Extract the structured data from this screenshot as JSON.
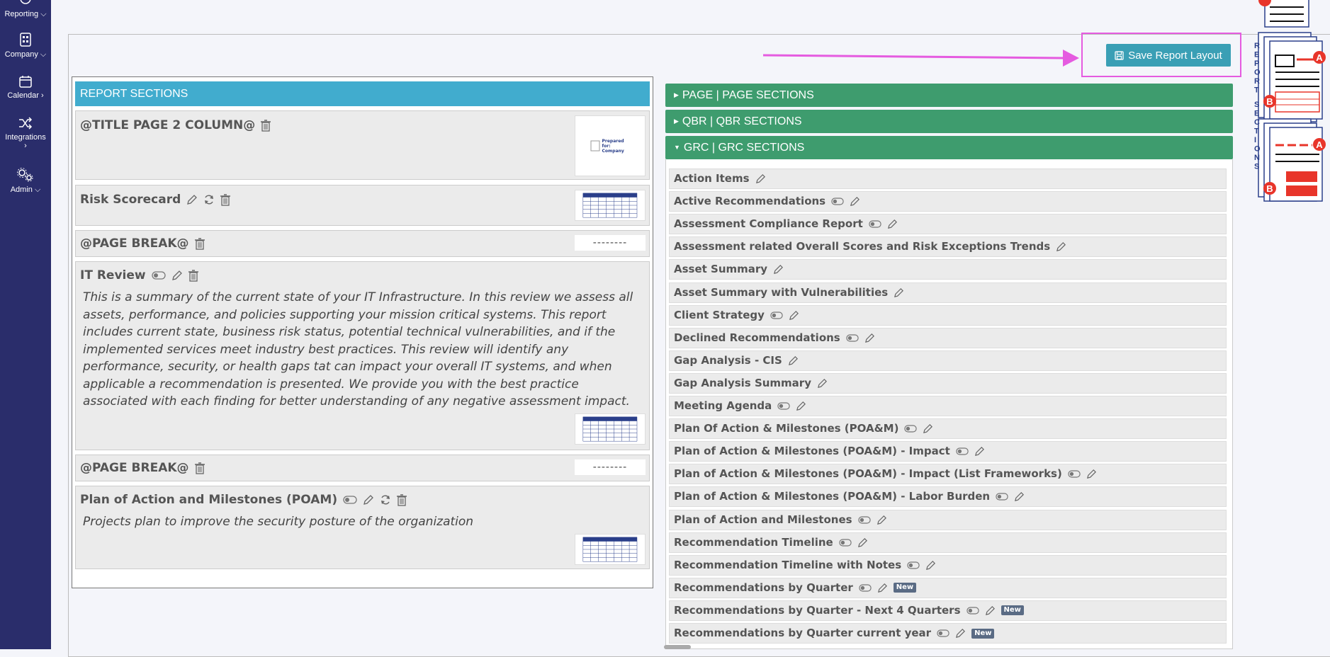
{
  "sidebar": {
    "items": [
      {
        "label": "Reporting",
        "icon": "reporting-icon",
        "caret": "⌵"
      },
      {
        "label": "Company",
        "icon": "company-building-icon",
        "caret": "⌵"
      },
      {
        "label": "Calendar",
        "icon": "calendar-icon",
        "caret": "›"
      },
      {
        "label": "Integrations",
        "icon": "shuffle-icon",
        "caret": "›"
      },
      {
        "label": "Admin",
        "icon": "gears-icon",
        "caret": "⌵"
      }
    ]
  },
  "toolbar": {
    "save_label": "Save Report Layout"
  },
  "report_sections": {
    "header": "REPORT SECTIONS",
    "cards": [
      {
        "title": "@TITLE PAGE 2 COLUMN@",
        "thumb_text": "Prepared for: Company"
      },
      {
        "title": "Risk Scorecard"
      },
      {
        "title": "@PAGE BREAK@",
        "dashes": "--------"
      },
      {
        "title": "IT Review",
        "description": "This is a summary of the current state of your IT Infrastructure. In this review we assess all assets, performance, and policies supporting your mission critical systems. This report includes current state, business risk status, potential technical vulnerabilities, and if the implemented services meet industry best practices. This review will identify any performance, security, or health gaps tat can impact your overall IT systems, and when applicable a recommendation is presented. We provide you with the best practice associated with each finding for better understanding of any negative assessment impact."
      },
      {
        "title": "@PAGE BREAK@",
        "dashes": "--------"
      },
      {
        "title": "Plan of Action and Milestones (POAM)",
        "description": "Projects plan to improve the security posture of the organization"
      }
    ]
  },
  "accordion": {
    "page": "PAGE | PAGE SECTIONS",
    "qbr": "QBR | QBR SECTIONS",
    "grc": "GRC | GRC SECTIONS"
  },
  "grc_items": [
    {
      "label": "Action Items",
      "toggle": false,
      "new": false
    },
    {
      "label": "Active Recommendations",
      "toggle": true,
      "new": false
    },
    {
      "label": "Assessment Compliance Report",
      "toggle": true,
      "new": false
    },
    {
      "label": "Assessment related Overall Scores and Risk Exceptions Trends",
      "toggle": false,
      "new": false
    },
    {
      "label": "Asset Summary",
      "toggle": false,
      "new": false
    },
    {
      "label": "Asset Summary with Vulnerabilities",
      "toggle": false,
      "new": false
    },
    {
      "label": "Client Strategy",
      "toggle": true,
      "new": false
    },
    {
      "label": "Declined Recommendations",
      "toggle": true,
      "new": false
    },
    {
      "label": "Gap Analysis - CIS",
      "toggle": false,
      "new": false
    },
    {
      "label": "Gap Analysis Summary",
      "toggle": false,
      "new": false
    },
    {
      "label": "Meeting Agenda",
      "toggle": true,
      "new": false
    },
    {
      "label": "Plan Of Action & Milestones (POA&M)",
      "toggle": true,
      "new": false
    },
    {
      "label": "Plan of Action & Milestones (POA&M) - Impact",
      "toggle": true,
      "new": false
    },
    {
      "label": "Plan of Action & Milestones (POA&M) - Impact (List Frameworks)",
      "toggle": true,
      "new": false
    },
    {
      "label": "Plan of Action & Milestones (POA&M) - Labor Burden",
      "toggle": true,
      "new": false
    },
    {
      "label": "Plan of Action and Milestones",
      "toggle": true,
      "new": false
    },
    {
      "label": "Recommendation Timeline",
      "toggle": true,
      "new": false
    },
    {
      "label": "Recommendation Timeline with Notes",
      "toggle": true,
      "new": false
    },
    {
      "label": "Recommendations by Quarter",
      "toggle": true,
      "new": true
    },
    {
      "label": "Recommendations by Quarter - Next 4 Quarters",
      "toggle": true,
      "new": true
    },
    {
      "label": "Recommendations by Quarter current year",
      "toggle": true,
      "new": true
    }
  ],
  "new_badge": "New",
  "side_illustration": {
    "vertical_text": "REPORT SECTIONS",
    "markers": [
      "A",
      "B"
    ]
  },
  "colors": {
    "sidebar": "#2a2d6b",
    "report_header": "#41acce",
    "accordion": "#3e9c6e",
    "save_button": "#3a9fb5",
    "highlight": "#e55be0",
    "marker_red": "#e8352a"
  }
}
